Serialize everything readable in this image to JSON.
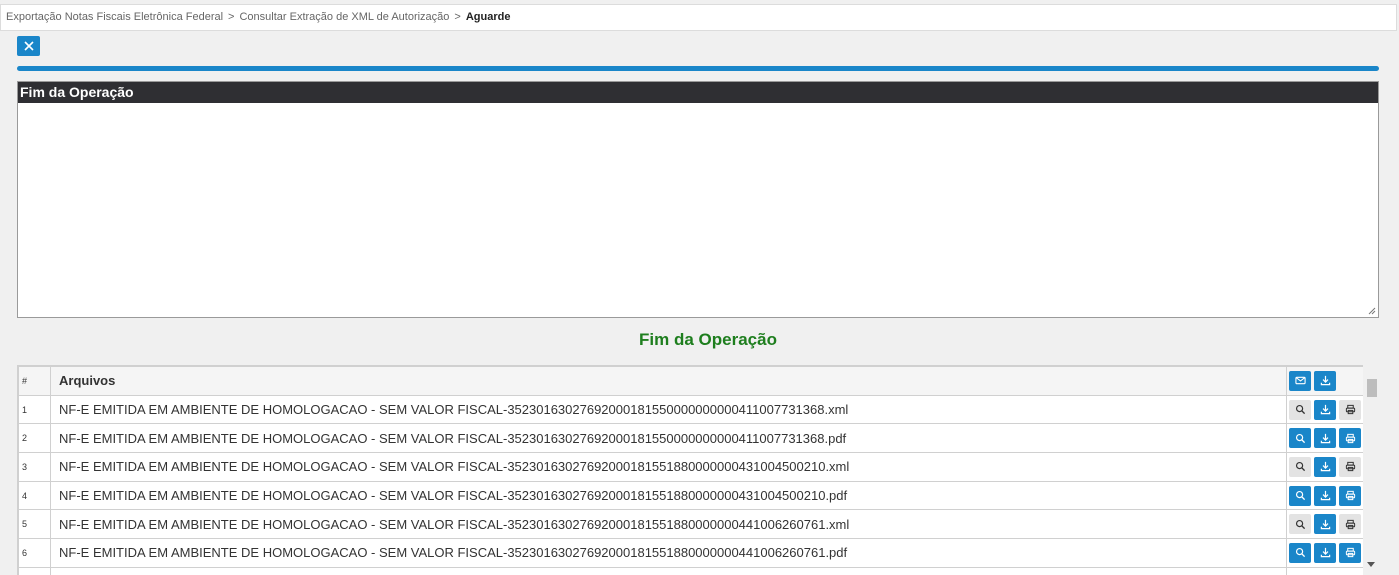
{
  "breadcrumb": {
    "items": [
      "Exportação Notas Fiscais Eletrônica Federal",
      "Consultar Extração de XML de Autorização"
    ],
    "separator": ">",
    "current": "Aguarde"
  },
  "progress": {
    "percent": 100,
    "color": "#1a86c9"
  },
  "log_panel": {
    "title": "Fim da Operação",
    "content": ""
  },
  "status_message": "Fim da Operação",
  "table": {
    "headers": {
      "number": "#",
      "files": "Arquivos"
    },
    "header_actions": [
      "mail-icon",
      "download-icon"
    ],
    "rows": [
      {
        "num": "1",
        "name": "NF-E EMITIDA EM AMBIENTE DE HOMOLOGACAO - SEM VALOR FISCAL-35230163027692000181550000000000411007731368.xml",
        "type": "xml"
      },
      {
        "num": "2",
        "name": "NF-E EMITIDA EM AMBIENTE DE HOMOLOGACAO - SEM VALOR FISCAL-35230163027692000181550000000000411007731368.pdf",
        "type": "pdf"
      },
      {
        "num": "3",
        "name": "NF-E EMITIDA EM AMBIENTE DE HOMOLOGACAO - SEM VALOR FISCAL-35230163027692000181551880000000431004500210.xml",
        "type": "xml"
      },
      {
        "num": "4",
        "name": "NF-E EMITIDA EM AMBIENTE DE HOMOLOGACAO - SEM VALOR FISCAL-35230163027692000181551880000000431004500210.pdf",
        "type": "pdf"
      },
      {
        "num": "5",
        "name": "NF-E EMITIDA EM AMBIENTE DE HOMOLOGACAO - SEM VALOR FISCAL-35230163027692000181551880000000441006260761.xml",
        "type": "xml"
      },
      {
        "num": "6",
        "name": "NF-E EMITIDA EM AMBIENTE DE HOMOLOGACAO - SEM VALOR FISCAL-35230163027692000181551880000000441006260761.pdf",
        "type": "pdf"
      }
    ]
  },
  "colors": {
    "accent": "#1a86c9",
    "status_green": "#1e7e1e",
    "header_dark": "#2f2f33"
  }
}
